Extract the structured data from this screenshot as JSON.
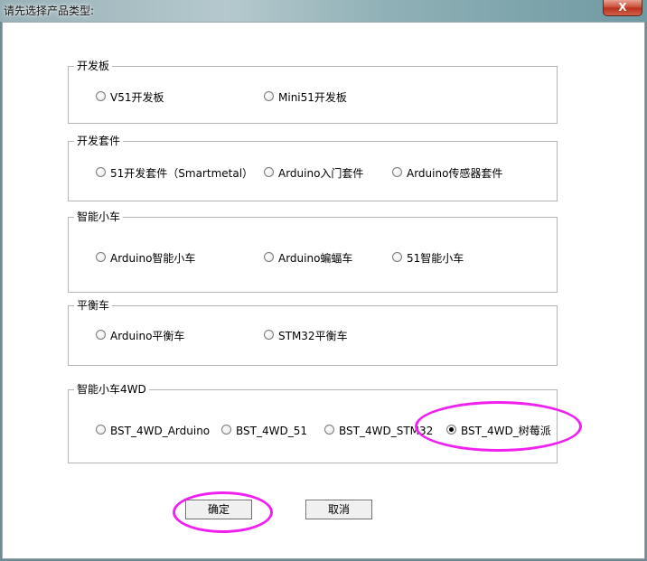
{
  "window": {
    "title": "请先选择产品类型:",
    "close_label": "X"
  },
  "groups": [
    {
      "label": "开发板",
      "options": [
        {
          "label": "V51开发板",
          "checked": false
        },
        {
          "label": "Mini51开发板",
          "checked": false
        }
      ]
    },
    {
      "label": "开发套件",
      "options": [
        {
          "label": "51开发套件（Smartmetal）",
          "checked": false
        },
        {
          "label": "Arduino入门套件",
          "checked": false
        },
        {
          "label": "Arduino传感器套件",
          "checked": false
        }
      ]
    },
    {
      "label": "智能小车",
      "options": [
        {
          "label": "Arduino智能小车",
          "checked": false
        },
        {
          "label": "Arduino蝙蝠车",
          "checked": false
        },
        {
          "label": "51智能小车",
          "checked": false
        }
      ]
    },
    {
      "label": "平衡车",
      "options": [
        {
          "label": "Arduino平衡车",
          "checked": false
        },
        {
          "label": "STM32平衡车",
          "checked": false
        }
      ]
    },
    {
      "label": "智能小车4WD",
      "options": [
        {
          "label": "BST_4WD_Arduino",
          "checked": false
        },
        {
          "label": "BST_4WD_51",
          "checked": false
        },
        {
          "label": "BST_4WD_STM32",
          "checked": false
        },
        {
          "label": "BST_4WD_树莓派",
          "checked": true
        }
      ]
    }
  ],
  "buttons": {
    "ok_label": "确定",
    "cancel_label": "取消"
  },
  "colors": {
    "highlight": "#f020f0"
  }
}
